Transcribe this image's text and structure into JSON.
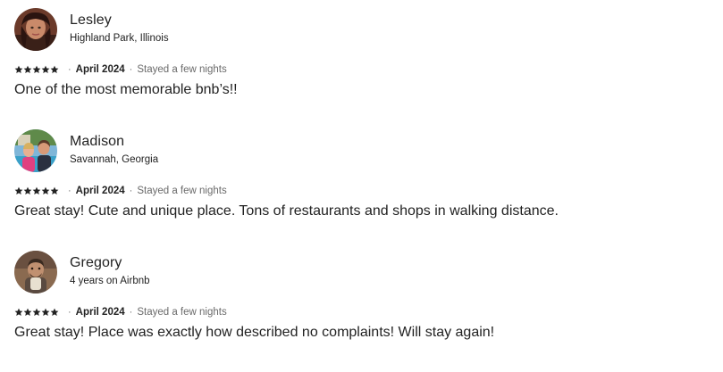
{
  "reviews": [
    {
      "name": "Lesley",
      "location": "Highland Park, Illinois",
      "rating": 5,
      "date": "April 2024",
      "stay": "Stayed a few nights",
      "text": "One of the most memorable bnb’s!!"
    },
    {
      "name": "Madison",
      "location": "Savannah, Georgia",
      "rating": 5,
      "date": "April 2024",
      "stay": "Stayed a few nights",
      "text": "Great stay! Cute and unique place. Tons of restaurants and shops in walking distance."
    },
    {
      "name": "Gregory",
      "location": "4 years on Airbnb",
      "rating": 5,
      "date": "April 2024",
      "stay": "Stayed a few nights",
      "text": "Great stay! Place was exactly how described no complaints! Will stay again!"
    }
  ],
  "separator": "·",
  "icons": {
    "star": "star-icon"
  },
  "colors": {
    "text": "#222222",
    "muted": "#6a6a6a"
  }
}
